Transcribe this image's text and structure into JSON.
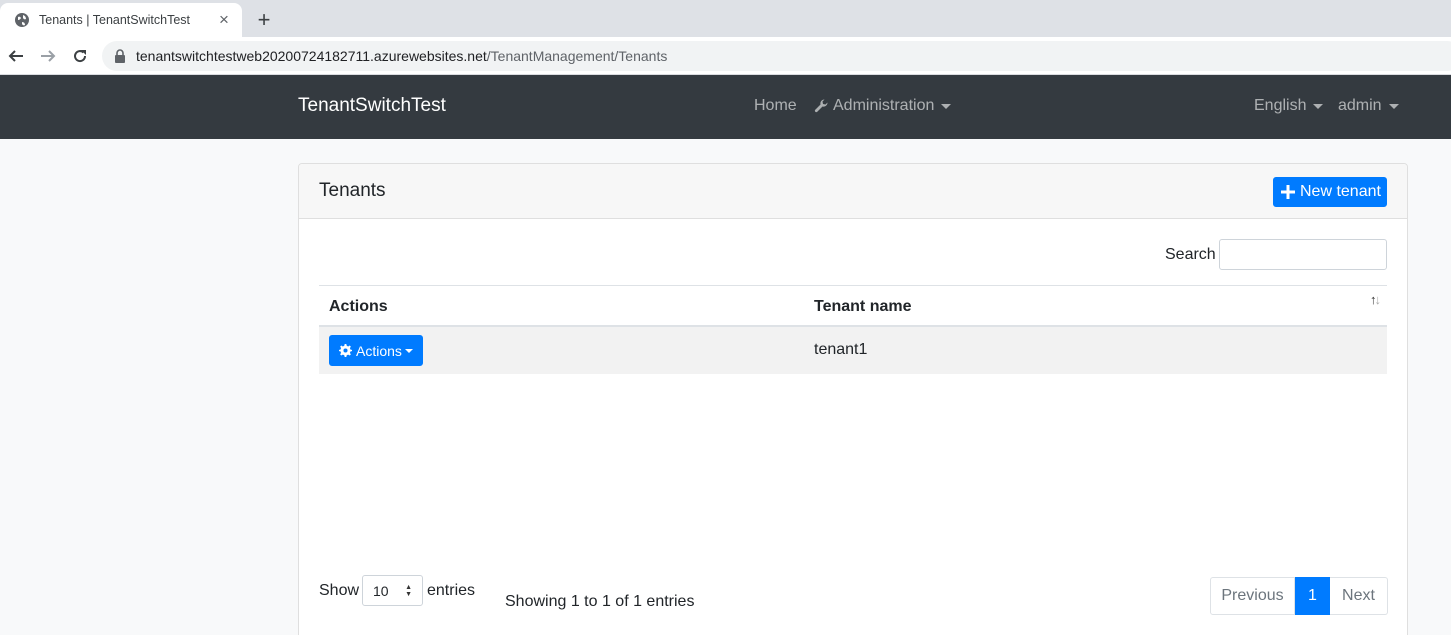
{
  "browser": {
    "tab_title": "Tenants | TenantSwitchTest",
    "url_host": "tenantswitchtestweb20200724182711.azurewebsites.net",
    "url_path": "/TenantManagement/Tenants"
  },
  "navbar": {
    "brand": "TenantSwitchTest",
    "home": "Home",
    "administration": "Administration",
    "language": "English",
    "user": "admin"
  },
  "card": {
    "title": "Tenants",
    "new_tenant_label": "New tenant"
  },
  "search": {
    "label": "Search",
    "value": ""
  },
  "table": {
    "columns": [
      "Actions",
      "Tenant name"
    ],
    "rows": [
      {
        "actions_label": "Actions",
        "tenant_name": "tenant1"
      }
    ]
  },
  "footer": {
    "show_label": "Show",
    "page_length": "10",
    "entries_label": "entries",
    "info": "Showing 1 to 1 of 1 entries",
    "previous": "Previous",
    "current_page": "1",
    "next": "Next"
  },
  "colors": {
    "primary": "#007bff",
    "navbar_bg": "#343a40"
  }
}
